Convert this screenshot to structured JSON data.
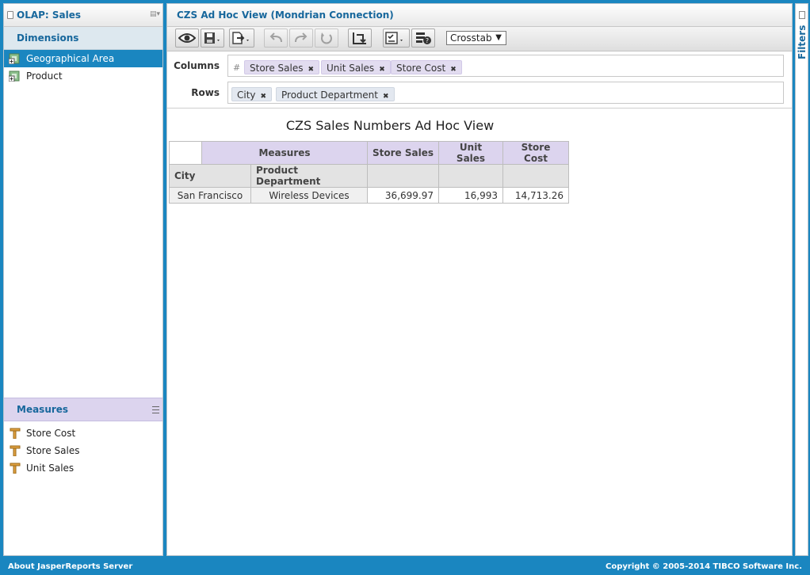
{
  "left_panel": {
    "title": "OLAP: Sales",
    "dimensions_title": "Dimensions",
    "dimensions": [
      {
        "label": "Geographical Area",
        "selected": true
      },
      {
        "label": "Product",
        "selected": false
      }
    ],
    "measures_title": "Measures",
    "measures": [
      {
        "label": "Store Cost"
      },
      {
        "label": "Store Sales"
      },
      {
        "label": "Unit Sales"
      }
    ]
  },
  "main": {
    "title": "CZS Ad Hoc View (Mondrian Connection)",
    "view_type": "Crosstab",
    "columns_label": "Columns",
    "rows_label": "Rows",
    "columns": [
      {
        "label": "Store Sales"
      },
      {
        "label": "Unit Sales"
      },
      {
        "label": "Store Cost"
      }
    ],
    "columns_prefix": "#",
    "rows": [
      {
        "label": "City"
      },
      {
        "label": "Product Department"
      }
    ],
    "report_title": "CZS Sales Numbers Ad Hoc View",
    "table": {
      "measures_header": "Measures",
      "measure_headers": [
        "Store Sales",
        "Unit Sales",
        "Store Cost"
      ],
      "row_headers": [
        "City",
        "Product Department"
      ],
      "rows": [
        {
          "city": "San Francisco",
          "department": "Wireless Devices",
          "store_sales": "36,699.97",
          "unit_sales": "16,993",
          "store_cost": "14,713.26"
        }
      ]
    }
  },
  "filters_panel": {
    "label": "Filters"
  },
  "footer": {
    "left": "About JasperReports Server",
    "right": "Copyright © 2005-2014 TIBCO Software Inc."
  },
  "colors": {
    "accent": "#1a86c0",
    "title_text": "#17679c",
    "measures_bg": "#dcd4ee"
  },
  "icons": {
    "toolbar": [
      "eye-icon",
      "save-icon",
      "export-icon",
      "undo-icon",
      "redo-icon",
      "undo-all-icon",
      "pivot-icon",
      "options-icon",
      "data-options-icon"
    ]
  }
}
